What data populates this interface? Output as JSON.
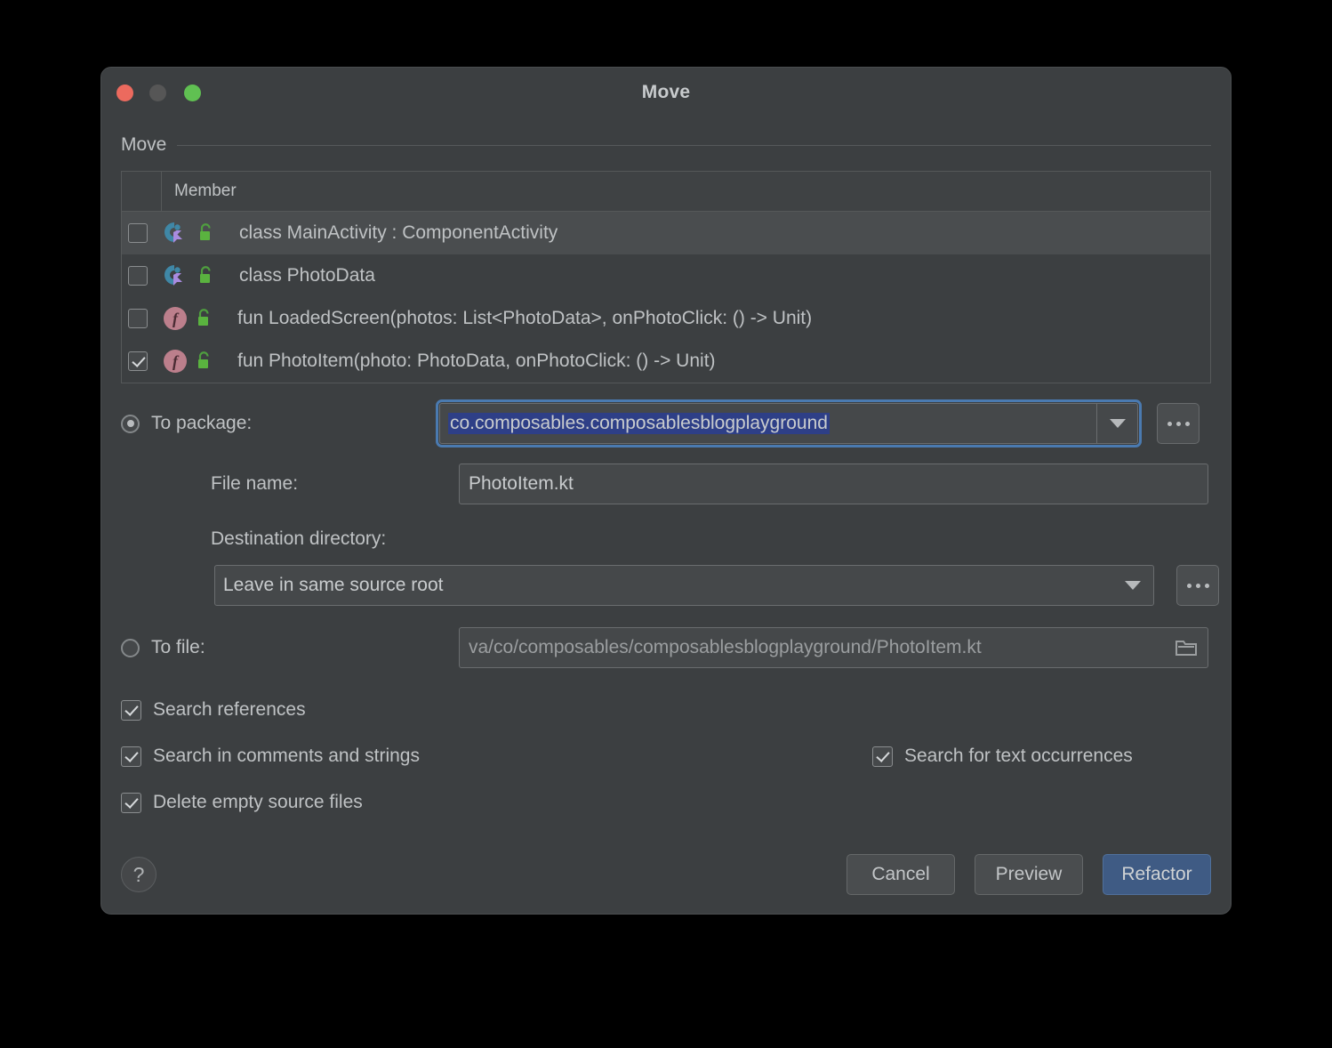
{
  "window": {
    "title": "Move",
    "traffic_lights": [
      {
        "name": "close",
        "color": "#ec6a5e"
      },
      {
        "name": "minimize",
        "color": "#565656"
      },
      {
        "name": "zoom",
        "color": "#60c052"
      }
    ]
  },
  "section": {
    "label": "Move"
  },
  "table": {
    "columns": [
      "Member"
    ],
    "rows": [
      {
        "checked": false,
        "icon": "kotlin-class-icon",
        "visibility_icon": "unlocked-padlock-icon",
        "label": "class MainActivity : ComponentActivity",
        "selected": true
      },
      {
        "checked": false,
        "icon": "kotlin-class-icon",
        "visibility_icon": "unlocked-padlock-icon",
        "label": "class PhotoData",
        "selected": false
      },
      {
        "checked": false,
        "icon": "kotlin-function-icon",
        "visibility_icon": "unlocked-padlock-icon",
        "label": "fun LoadedScreen(photos: List<PhotoData>, onPhotoClick: () -> Unit)",
        "selected": false
      },
      {
        "checked": true,
        "icon": "kotlin-function-icon",
        "visibility_icon": "unlocked-padlock-icon",
        "label": "fun PhotoItem(photo: PhotoData, onPhotoClick: () -> Unit)",
        "selected": false
      }
    ]
  },
  "form": {
    "to_package": {
      "radio_label": "To package:",
      "selected": true,
      "value": "co.composables.composablesblogplayground",
      "text_selected": true,
      "browse_label": "..."
    },
    "file_name": {
      "label": "File name:",
      "value": "PhotoItem.kt"
    },
    "destination_directory": {
      "label": "Destination directory:",
      "value": "Leave in same source root",
      "browse_label": "..."
    },
    "to_file": {
      "radio_label": "To file:",
      "selected": false,
      "value": "va/co/composables/composablesblogplayground/PhotoItem.kt"
    }
  },
  "options": [
    {
      "label": "Search references",
      "checked": true
    },
    {
      "label": "Search in comments and strings",
      "checked": true
    },
    {
      "label": "Delete empty source files",
      "checked": true
    }
  ],
  "options_right": [
    {
      "label": "Search for text occurrences",
      "checked": true
    }
  ],
  "footer": {
    "help_label": "?",
    "cancel_label": "Cancel",
    "preview_label": "Preview",
    "refactor_label": "Refactor"
  },
  "colors": {
    "dialog_bg": "#3c3f41",
    "accent_primary": "#3f5b84",
    "selection_highlight": "#2e3f87",
    "focus_ring": "#4a7ab0",
    "lock_green": "#4f9e3f",
    "kotlin_teal": "#3f87a6",
    "kotlin_purple": "#a98be0",
    "function_pink": "#bc7f8c"
  }
}
